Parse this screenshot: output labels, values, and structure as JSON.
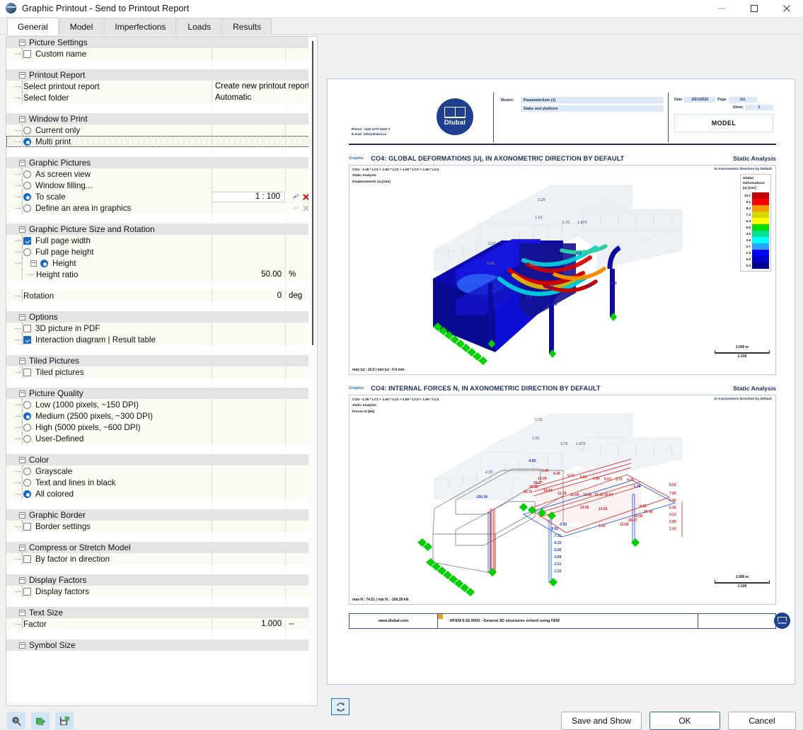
{
  "window": {
    "title": "Graphic Printout - Send to Printout Report",
    "minimize": "–",
    "maximize": "□",
    "close": "✕"
  },
  "tabs": [
    {
      "label": "General",
      "active": true
    },
    {
      "label": "Model",
      "active": false
    },
    {
      "label": "Imperfections",
      "active": false
    },
    {
      "label": "Loads",
      "active": false
    },
    {
      "label": "Results",
      "active": false
    }
  ],
  "groups": [
    {
      "title": "Picture Settings",
      "rows": [
        {
          "kind": "checkbox",
          "label": "Custom name",
          "checked": false,
          "value": "",
          "unit": ""
        }
      ]
    },
    {
      "title": "Printout Report",
      "rows": [
        {
          "kind": "text",
          "label": "Select printout report",
          "value": "Create new printout report",
          "unit": ""
        },
        {
          "kind": "text",
          "label": "Select folder",
          "value": "Automatic",
          "unit": ""
        }
      ]
    },
    {
      "title": "Window to Print",
      "rows": [
        {
          "kind": "radio",
          "label": "Current only",
          "checked": false,
          "value": "",
          "unit": ""
        },
        {
          "kind": "radio",
          "label": "Multi print",
          "checked": true,
          "selected": true,
          "value": "",
          "unit": ""
        }
      ]
    },
    {
      "title": "Graphic Pictures",
      "rows": [
        {
          "kind": "radio",
          "label": "As screen view",
          "checked": false,
          "value": "",
          "unit": ""
        },
        {
          "kind": "radio",
          "label": "Window filling...",
          "checked": false,
          "value": "",
          "unit": ""
        },
        {
          "kind": "radio",
          "label": "To scale",
          "checked": true,
          "value": "1 : 100",
          "unit": "",
          "editor": true
        },
        {
          "kind": "radio",
          "label": "Define an area in graphics",
          "checked": false,
          "value": "",
          "unit": "",
          "editor2": true
        }
      ]
    },
    {
      "title": "Graphic Picture Size and Rotation",
      "rows": [
        {
          "kind": "checkbox",
          "label": "Full page width",
          "checked": true,
          "value": "",
          "unit": ""
        },
        {
          "kind": "radio",
          "label": "Full page height",
          "checked": false,
          "value": "",
          "unit": ""
        },
        {
          "kind": "radio",
          "label": "Height",
          "checked": true,
          "value": "",
          "unit": "",
          "expandable": true
        },
        {
          "kind": "plain",
          "label": "Height ratio",
          "value": "50.00",
          "unit": "%",
          "indent": 2
        },
        {
          "kind": "spacer"
        },
        {
          "kind": "plain",
          "label": "Rotation",
          "value": "0",
          "unit": "deg",
          "indent": 1
        }
      ]
    },
    {
      "title": "Options",
      "rows": [
        {
          "kind": "checkbox",
          "label": "3D picture in PDF",
          "checked": false,
          "value": "",
          "unit": ""
        },
        {
          "kind": "checkbox",
          "label": "Interaction diagram | Result table",
          "checked": true,
          "value": "",
          "unit": ""
        }
      ]
    },
    {
      "title": "Tiled Pictures",
      "rows": [
        {
          "kind": "checkbox",
          "label": "Tiled pictures",
          "checked": false,
          "value": "",
          "unit": ""
        }
      ]
    },
    {
      "title": "Picture Quality",
      "rows": [
        {
          "kind": "radio",
          "label": "Low (1000 pixels, ~150 DPI)",
          "checked": false,
          "value": "",
          "unit": ""
        },
        {
          "kind": "radio",
          "label": "Medium (2500 pixels, ~300 DPI)",
          "checked": true,
          "value": "",
          "unit": ""
        },
        {
          "kind": "radio",
          "label": "High (5000 pixels, ~600 DPI)",
          "checked": false,
          "value": "",
          "unit": ""
        },
        {
          "kind": "radio",
          "label": "User-Defined",
          "checked": false,
          "value": "",
          "unit": ""
        }
      ]
    },
    {
      "title": "Color",
      "rows": [
        {
          "kind": "radio",
          "label": "Grayscale",
          "checked": false,
          "value": "",
          "unit": ""
        },
        {
          "kind": "radio",
          "label": "Text and lines in black",
          "checked": false,
          "value": "",
          "unit": ""
        },
        {
          "kind": "radio",
          "label": "All colored",
          "checked": true,
          "value": "",
          "unit": ""
        }
      ]
    },
    {
      "title": "Graphic Border",
      "rows": [
        {
          "kind": "checkbox",
          "label": "Border settings",
          "checked": false,
          "value": "",
          "unit": ""
        }
      ]
    },
    {
      "title": "Compress or Stretch Model",
      "rows": [
        {
          "kind": "checkbox",
          "label": "By factor in direction",
          "checked": false,
          "value": "",
          "unit": ""
        }
      ]
    },
    {
      "title": "Display Factors",
      "rows": [
        {
          "kind": "checkbox",
          "label": "Display factors",
          "checked": false,
          "value": "",
          "unit": ""
        }
      ]
    },
    {
      "title": "Text Size",
      "rows": [
        {
          "kind": "plain",
          "label": "Factor",
          "value": "1.000",
          "unit": "--",
          "indent": 1
        }
      ]
    },
    {
      "title": "Symbol Size",
      "rows": []
    }
  ],
  "preview": {
    "header": {
      "phone": "Phone: +420 2272 0320 3",
      "email": "E-mail: info@dlubal.cz",
      "logo_text": "Dlubal",
      "model_key": "Model:",
      "model_name": "Parameterliste (1)",
      "model_desc": "Slabs and platform",
      "date_key": "Date",
      "date_value": "3/21/2022",
      "page_key": "Page",
      "page_value": "1/1",
      "sheet_key": "Sheet",
      "sheet_value": "1",
      "model_box": "MODEL"
    },
    "figures": [
      {
        "badge": "Graphic",
        "title": "CO4: GLOBAL DEFORMATIONS |U|, IN AXONOMETRIC DIRECTION BY DEFAULT",
        "analysis": "Static Analysis",
        "info_line1": "CO4 - 1.35 * LC1 + 1.50 * LC2 + 1.50 * LC3 + 1.50 * LC4",
        "info_line2": "Static Analysis",
        "info_line3": "Displacements |u| [mm]",
        "direction": "In Axonometric Direction by Default",
        "minmax": "max |u| : 10.0 | min |u| : 0.0 mm",
        "scale_length": "2.000 m",
        "scale_ratio": "1:100",
        "legend": {
          "title_lines": [
            "Global",
            "Deformations",
            "|u| [mm]"
          ],
          "entries": [
            {
              "value": "10.0",
              "color": "#c00000"
            },
            {
              "value": "9.1",
              "color": "#f50000"
            },
            {
              "value": "8.2",
              "color": "#f59b00"
            },
            {
              "value": "7.3",
              "color": "#d6d600"
            },
            {
              "value": "6.4",
              "color": "#ffff00"
            },
            {
              "value": "5.5",
              "color": "#00e000"
            },
            {
              "value": "4.6",
              "color": "#00e090"
            },
            {
              "value": "3.6",
              "color": "#00ffff"
            },
            {
              "value": "2.7",
              "color": "#2aa3ff"
            },
            {
              "value": "1.8",
              "color": "#0000ff"
            },
            {
              "value": "0.9",
              "color": "#0000c8"
            },
            {
              "value": "0.0",
              "color": "#000090"
            }
          ]
        },
        "model_labels": [
          "2.25",
          "1.01",
          "3.75",
          "1.875",
          "2.25",
          "1.01",
          "1.875",
          "4.5",
          "10.0",
          "10.0",
          "3.4",
          "1.0",
          "0.3",
          "4.8",
          "6.6"
        ]
      },
      {
        "badge": "Graphic",
        "title": "CO4: INTERNAL FORCES N, IN AXONOMETRIC DIRECTION BY DEFAULT",
        "analysis": "Static Analysis",
        "info_line1": "CO4 - 1.35 * LC1 + 1.50 * LC2 + 1.50 * LC3 + 1.50 * LC4",
        "info_line2": "Static Analysis",
        "info_line3": "Forces N [kN]",
        "direction": "In Axonometric Direction by Default",
        "minmax": "max N : 74.51 | min N : -166.29 kN",
        "scale_length": "2.000 m",
        "scale_ratio": "1:100",
        "model_labels_red": [
          "2.45",
          "4.35",
          "5.72",
          "6.52",
          "6.80",
          "6.53",
          "5.72",
          "4.35",
          "14.34",
          "26.27",
          "38.40",
          "59.79",
          "10.64",
          "12.19",
          "12.69",
          "12.69",
          "12.19",
          "10.64",
          "14.56",
          "14.56",
          "9.02",
          "7.86",
          "6.66",
          "5.42",
          "4.13",
          "2.80",
          "1.42",
          "4.68",
          "10.49",
          "10.40",
          "10.47",
          "10.89",
          "5.02",
          "8.94"
        ],
        "model_labels_blue": [
          "-4.65",
          "-156.34",
          "-7.31",
          "-6.20",
          "-5.06",
          "-3.89",
          "-2.61",
          "-1.33",
          "-1.29",
          "-0.92",
          "-6.82"
        ],
        "model_labels_gray": [
          "2.25",
          "1.01",
          "3.75",
          "1.875",
          "2.25"
        ]
      }
    ],
    "footer": {
      "website": "www.dlubal.com",
      "program": "RFEM 6.02.0003 - General 3D structures solved using FEM"
    },
    "refresh_icon": "refresh"
  },
  "bottom": {
    "tools": [
      {
        "name": "help-tool",
        "glyph": "?"
      },
      {
        "name": "import-tool",
        "glyph": "↪"
      },
      {
        "name": "save-tool",
        "glyph": "▣"
      }
    ],
    "save_and_show": "Save and Show",
    "ok": "OK",
    "cancel": "Cancel"
  }
}
